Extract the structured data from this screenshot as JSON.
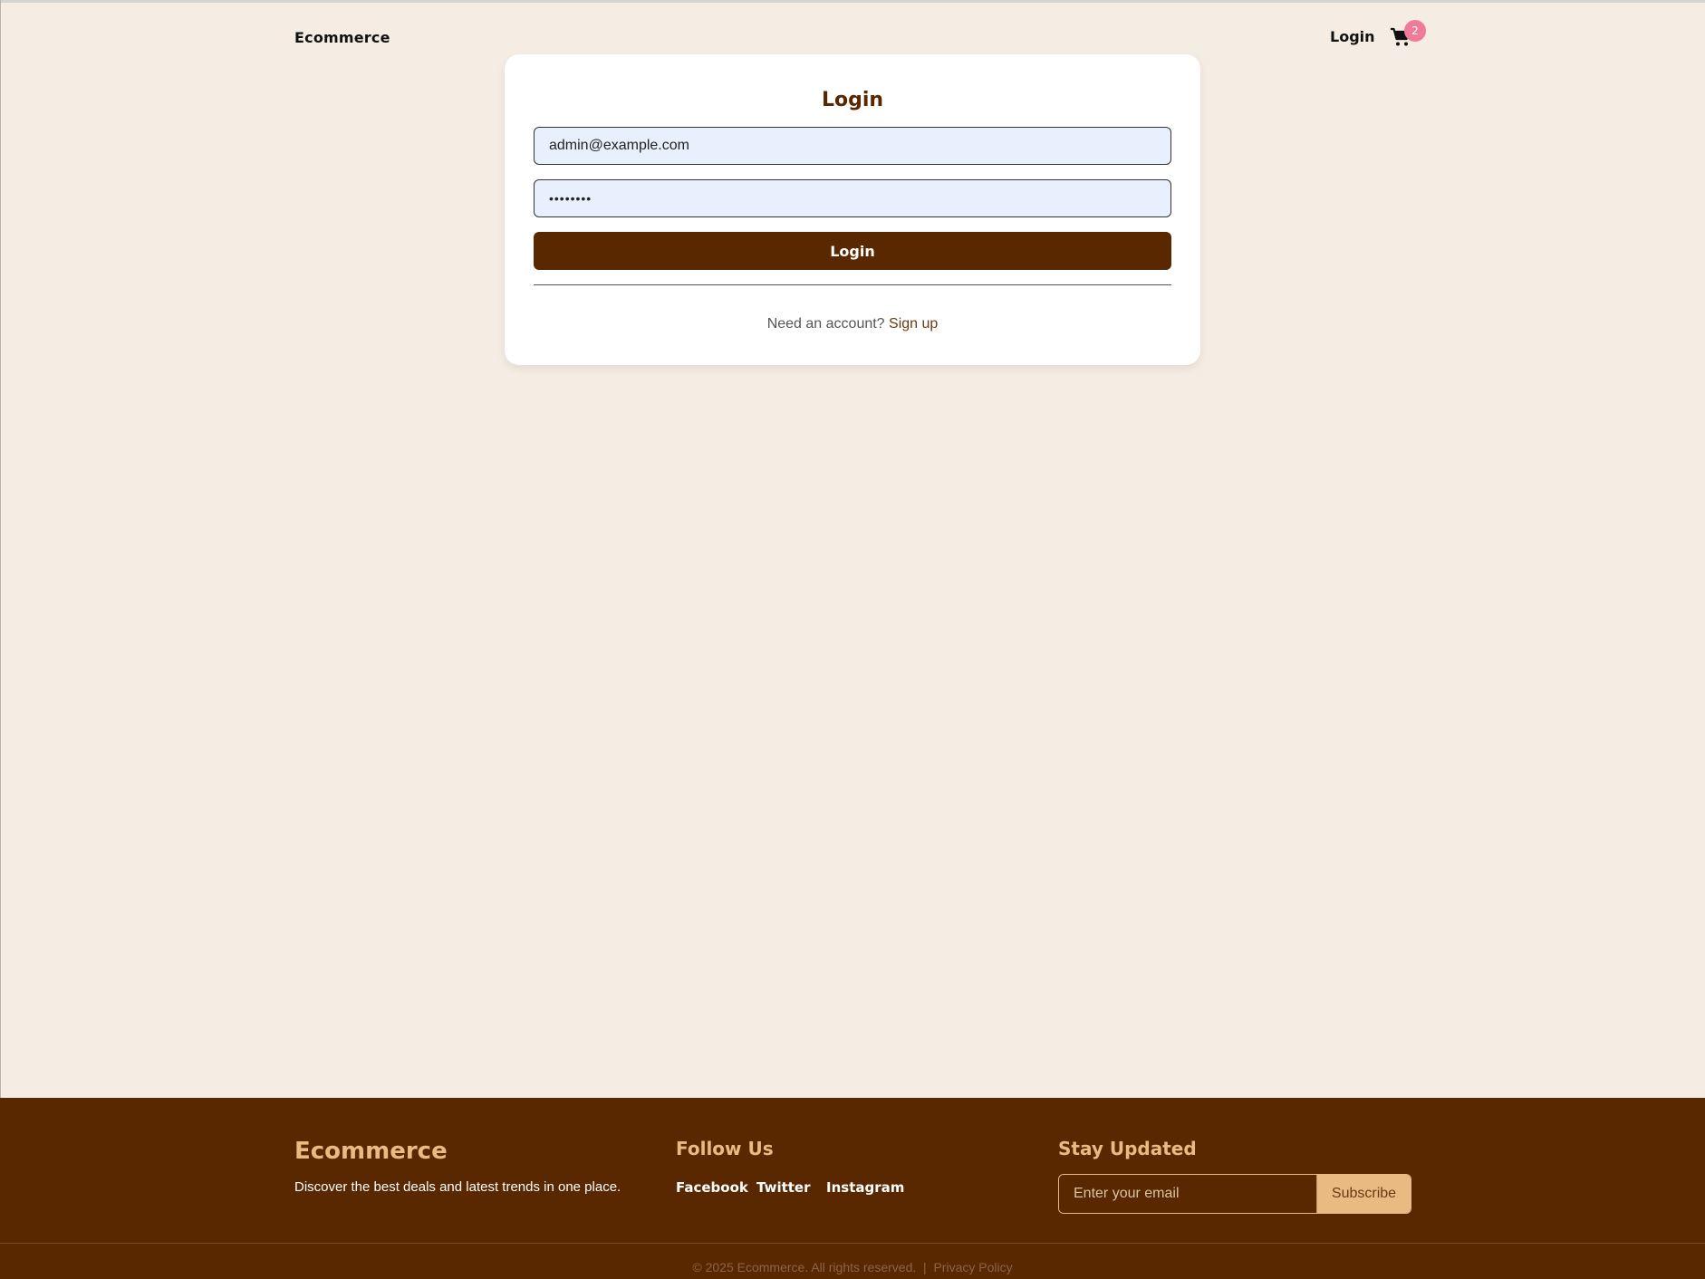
{
  "header": {
    "brand": "Ecommerce",
    "login_label": "Login",
    "cart_icon": "cart-icon",
    "cart_count": "2"
  },
  "login": {
    "title": "Login",
    "email_value": "admin@example.com",
    "password_value": "••••••••",
    "submit_label": "Login",
    "need_account_text": "Need an account?",
    "signup_link": "Sign up"
  },
  "footer": {
    "brand": "Ecommerce",
    "tagline": "Discover the best deals and latest trends in one place.",
    "follow_title": "Follow Us",
    "social": [
      "Facebook",
      "Twitter",
      "Instagram"
    ],
    "newsletter_title": "Stay Updated",
    "email_placeholder": "Enter your email",
    "subscribe_label": "Subscribe",
    "copyright": "© 2025 Ecommerce. All rights reserved.",
    "separator": "|",
    "privacy_label": "Privacy Policy"
  },
  "colors": {
    "background": "#f5ede3",
    "primary": "#5a2800",
    "accent": "#e9bb83",
    "badge": "#f07a9a",
    "input_fill": "#e8f0fe"
  }
}
